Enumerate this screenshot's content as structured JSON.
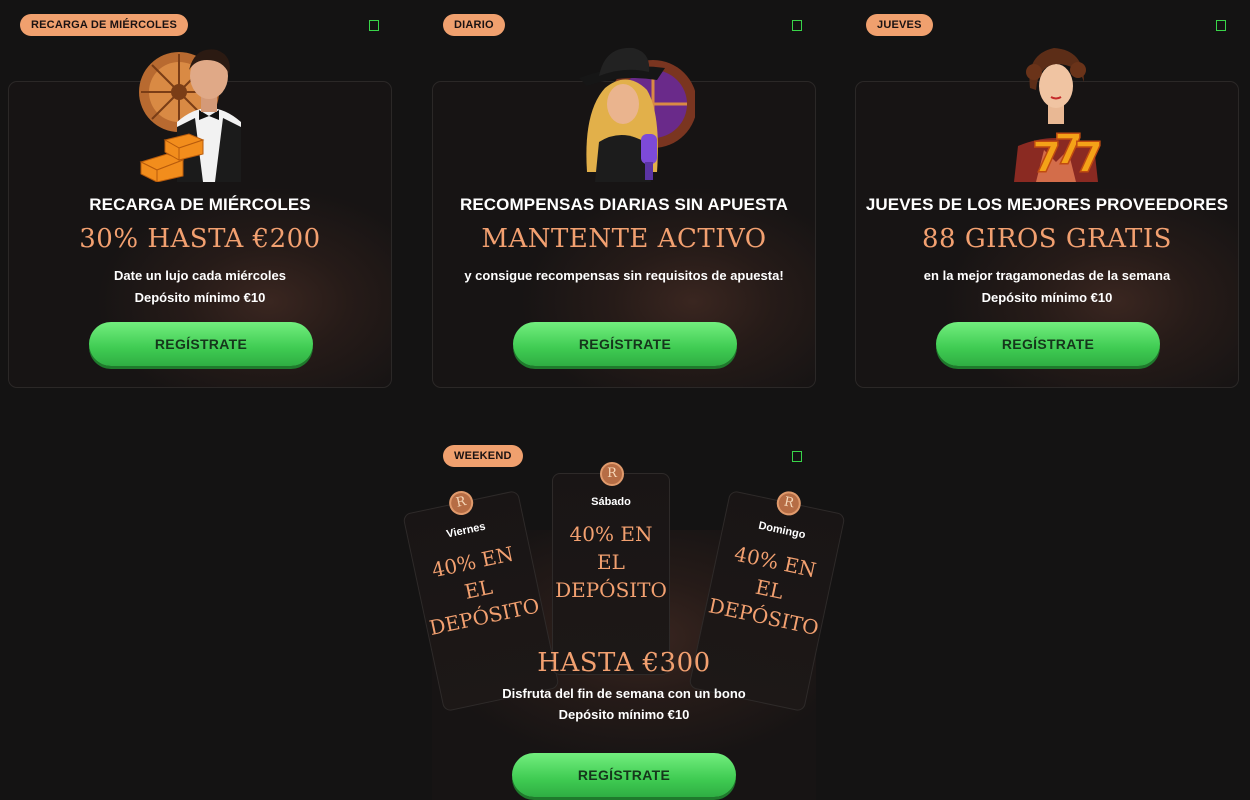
{
  "promos": [
    {
      "tag": "RECARGA DE MIÉRCOLES",
      "title": "RECARGA DE MIÉRCOLES",
      "headline": "30% HASTA €200",
      "line1": "Date un lujo cada miércoles",
      "line2": "Depósito mínimo €10",
      "cta": "REGÍSTRATE"
    },
    {
      "tag": "DIARIO",
      "title": "RECOMPENSAS DIARIAS SIN APUESTA",
      "headline": "MANTENTE ACTIVO",
      "line1": "y consigue recompensas sin requisitos de apuesta!",
      "line2": "",
      "cta": "REGÍSTRATE"
    },
    {
      "tag": "JUEVES",
      "title": "JUEVES DE LOS MEJORES PROVEEDORES",
      "headline": "88 GIROS GRATIS",
      "line1": "en la mejor tragamonedas de la semana",
      "line2": "Depósito mínimo €10",
      "cta": "REGÍSTRATE"
    }
  ],
  "weekend": {
    "tag": "WEEKEND",
    "coin_letter": "R",
    "cards": [
      {
        "day": "Viernes",
        "offer": "40% EN EL DEPÓSITO"
      },
      {
        "day": "Sábado",
        "offer": "40% EN EL DEPÓSITO"
      },
      {
        "day": "Domingo",
        "offer": "40% EN EL DEPÓSITO"
      }
    ],
    "headline": "HASTA €300",
    "line1": "Disfruta del fin de semana con un bono",
    "line2": "Depósito mínimo €10",
    "cta": "REGÍSTRATE"
  },
  "colors": {
    "accent": "#f2a070",
    "tag_bg": "#f0a06e",
    "button_green": "#3fcb52",
    "background": "#141313"
  }
}
